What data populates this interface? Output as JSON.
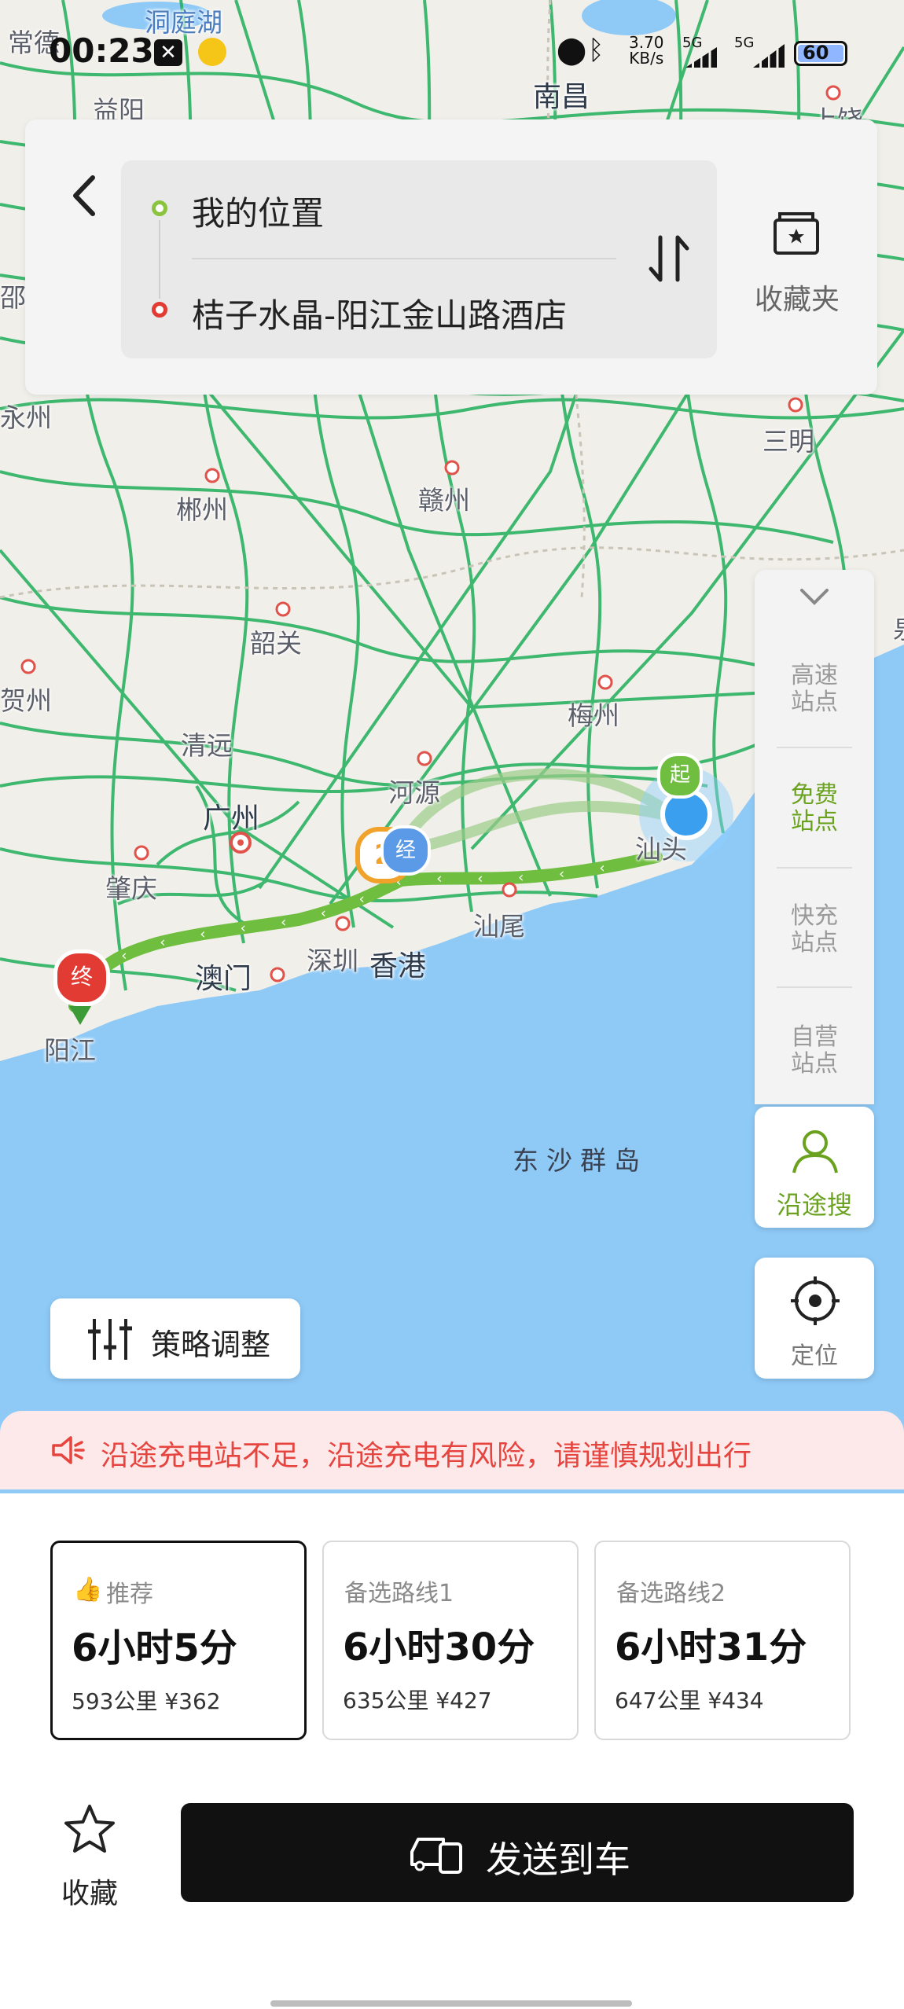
{
  "status_bar": {
    "time": "00:23",
    "net_speed_value": "3.70",
    "net_speed_unit": "KB/s",
    "sig1": "5G",
    "sig2": "5G",
    "battery": "60"
  },
  "route": {
    "origin": "我的位置",
    "destination": "桔子水晶-阳江金山路酒店",
    "favorites_label": "收藏夹"
  },
  "map_labels": {
    "l1": "常德",
    "l2": "洞庭湖",
    "l3": "南昌",
    "l4": "益阳",
    "l5": "上饶",
    "l6": "永州",
    "l7": "邵",
    "l8": "三明",
    "l9": "郴州",
    "l10": "赣州",
    "l11": "韶关",
    "l12": "贺州",
    "l13": "梅州",
    "l14": "清远",
    "l15": "河源",
    "l16": "广州",
    "l17": "肇庆",
    "l18": "汕头",
    "l19": "汕尾",
    "l20": "深圳",
    "l21": "香港",
    "l22": "澳门",
    "l23": "阳江",
    "l24": "东沙群岛",
    "l25": "泉"
  },
  "markers": {
    "start": "起",
    "end": "终",
    "via": "经",
    "via_count": "2"
  },
  "side_panel": {
    "highway": "高速站点",
    "free": "免费站点",
    "fast": "快充站点",
    "own": "自营站点",
    "along": "沿途搜",
    "locate": "定位"
  },
  "strategy_label": "策略调整",
  "warning": "沿途充电站不足，沿途充电有风险，请谨慎规划出行",
  "route_options": [
    {
      "tag": "推荐",
      "time": "6小时5分",
      "distance": "593公里",
      "price": "¥362"
    },
    {
      "tag": "备选路线1",
      "time": "6小时30分",
      "distance": "635公里",
      "price": "¥427"
    },
    {
      "tag": "备选路线2",
      "time": "6小时31分",
      "distance": "647公里",
      "price": "¥434"
    }
  ],
  "bottom": {
    "favorite_label": "收藏",
    "send_label": "发送到车"
  },
  "colors": {
    "route_green": "#6fbe3f",
    "road_green": "#1fae5a",
    "sea_blue": "#8fcaf7",
    "warning_red": "#e6453f",
    "active_green": "#6aa21f"
  }
}
